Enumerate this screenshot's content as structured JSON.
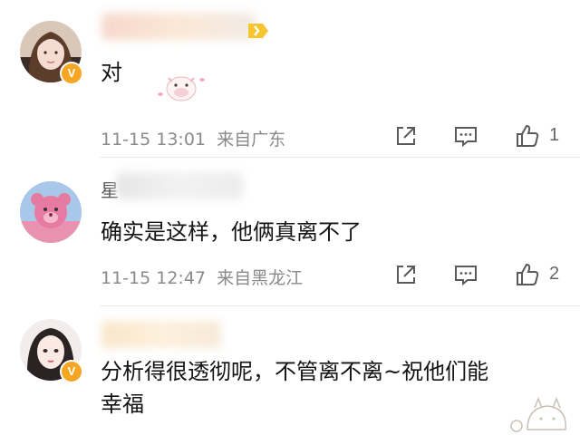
{
  "comments": [
    {
      "text": "对",
      "time": "11-15 13:01",
      "location": "来自广东",
      "likes": "1",
      "verified": "V",
      "avatar": "avatar-girl-long-hair",
      "has_level_badge": true,
      "has_emoji": "pink-cow-emoji"
    },
    {
      "name_initial": "星",
      "text": "确实是这样，他俩真离不了",
      "time": "11-15 12:47",
      "location": "来自黑龙江",
      "likes": "2",
      "avatar": "avatar-pink-bear"
    },
    {
      "text_line1": "分析得很透彻呢，不管离不离~祝他们能",
      "text_line2": "幸福",
      "verified": "V",
      "avatar": "avatar-drawn-girl"
    }
  ],
  "icons": {
    "share": "share-icon",
    "comment": "comment-icon",
    "like": "thumbs-up-icon"
  },
  "colors": {
    "text": "#141414",
    "meta": "#8a8a8a",
    "verified_badge": "#f5a623"
  }
}
